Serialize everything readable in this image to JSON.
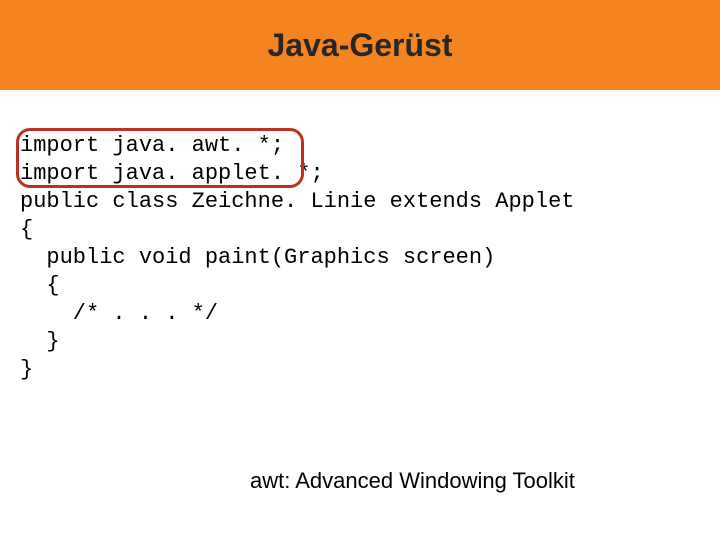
{
  "title": "Java-Gerüst",
  "code": {
    "l1": "import java. awt. *;",
    "l2": "import java. applet. *;",
    "l3": "public class Zeichne. Linie extends Applet",
    "l4": "{",
    "l5": "  public void paint(Graphics screen)",
    "l6": "  {",
    "l7": "    /* . . . */",
    "l8": "  }",
    "l9": "}"
  },
  "footnote": "awt: Advanced Windowing Toolkit"
}
